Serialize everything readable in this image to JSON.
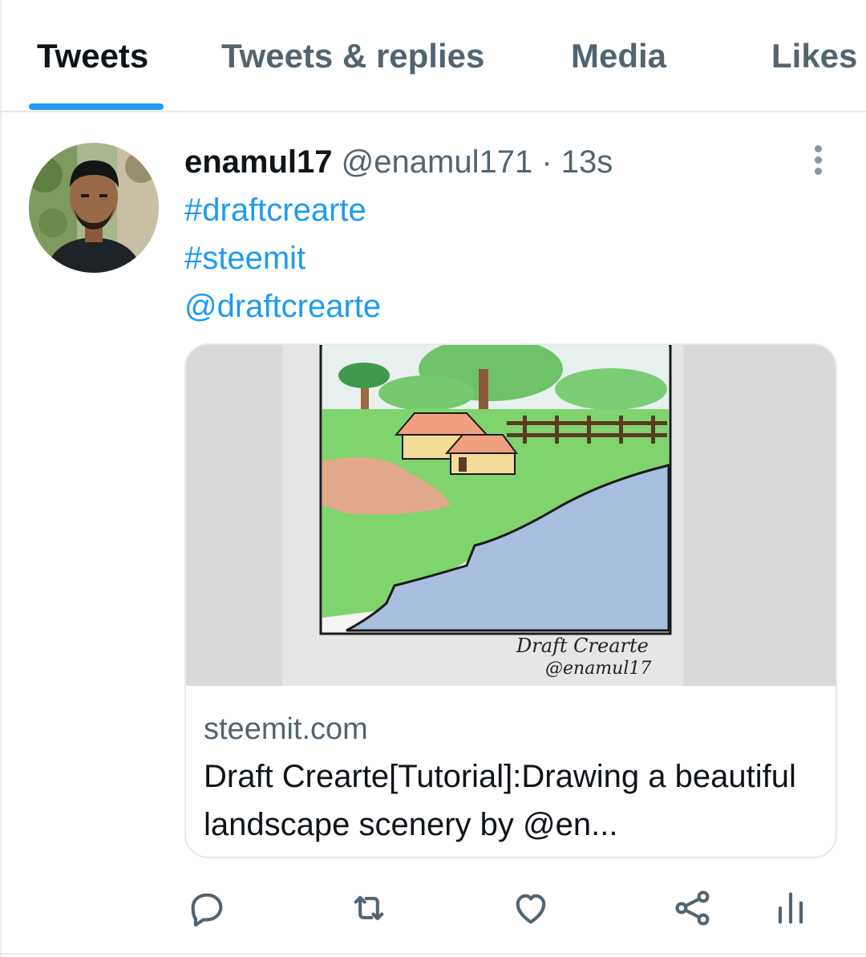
{
  "tabs": [
    {
      "label": "Tweets",
      "active": true
    },
    {
      "label": "Tweets & replies",
      "active": false
    },
    {
      "label": "Media",
      "active": false
    },
    {
      "label": "Likes",
      "active": false
    }
  ],
  "tweet": {
    "display_name": "enamul17",
    "handle": "@enamul171",
    "separator": "·",
    "time": "13s",
    "lines": [
      "#draftcrearte",
      "#steemit",
      "@draftcrearte"
    ],
    "card": {
      "domain": "steemit.com",
      "title": "Draft Crearte[Tutorial]:Drawing a beautiful landscape scenery by @en...",
      "image_signature_line1": "Draft Crearte",
      "image_signature_line2": "@enamul17"
    },
    "actions": [
      "reply-icon",
      "retweet-icon",
      "like-icon",
      "share-icon",
      "analytics-icon"
    ]
  },
  "colors": {
    "accent": "#1d9bf0",
    "text_primary": "#0f1419",
    "text_secondary": "#536471",
    "border": "#e7e9ea"
  }
}
